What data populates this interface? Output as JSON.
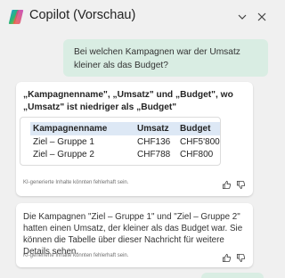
{
  "header": {
    "title": "Copilot (Vorschau)",
    "logo_icon": "copilot-logo",
    "collapse_icon": "chevron-down-icon",
    "close_icon": "close-icon"
  },
  "user_message": {
    "text": "Bei welchen Kampagnen war der Umsatz kleiner als das Budget?"
  },
  "response_card": {
    "heading": "„Kampagnenname\", „Umsatz\" und „Budget\", wo „Umsatz\" ist niedriger als „Budget\"",
    "table": {
      "headers": [
        "Kampagnenname",
        "Umsatz",
        "Budget"
      ],
      "rows": [
        [
          "Ziel – Gruppe 1",
          "CHF136",
          "CHF5'800"
        ],
        [
          "Ziel – Gruppe 2",
          "CHF788",
          "CHF800"
        ]
      ]
    },
    "disclaimer": "KI-generierte Inhalte könnten fehlerhaft sein."
  },
  "answer_card": {
    "text": "Die Kampagnen \"Ziel – Gruppe 1\" und \"Ziel – Gruppe 2\" hatten einen Umsatz, der kleiner als das Budget war. Sie können die Tabelle über dieser Nachricht für weitere Details sehen.",
    "disclaimer": "KI-generierte Inhalte könnten fehlerhaft sein."
  },
  "colors": {
    "background": "#f0f0f0",
    "user_bubble": "#d9ede3",
    "table_header": "#dde8f5",
    "card": "#ffffff"
  }
}
